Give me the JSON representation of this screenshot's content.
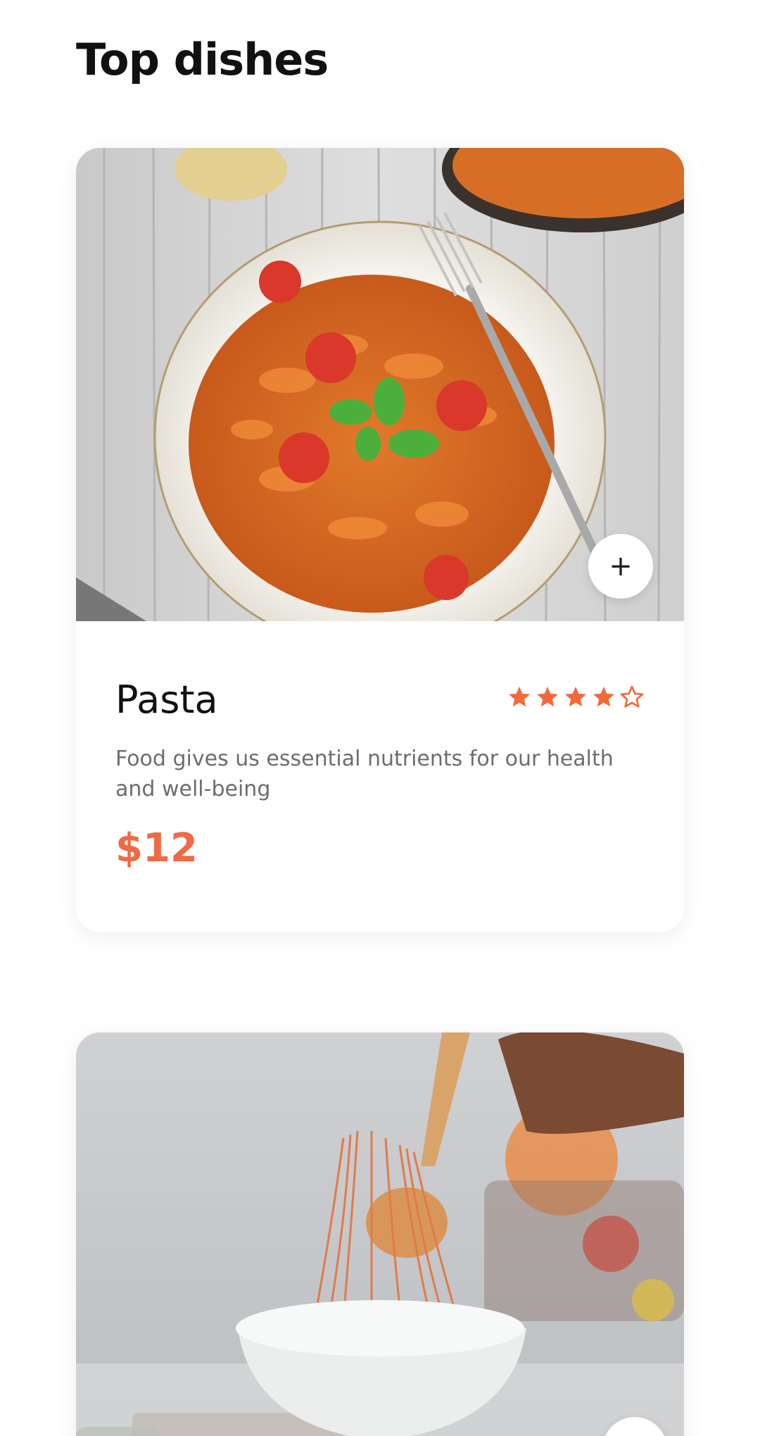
{
  "section": {
    "title": "Top dishes"
  },
  "dishes": [
    {
      "name": "Pasta",
      "rating": 4,
      "rating_max": 5,
      "description": "Food gives us essential nutrients for our health and well-being",
      "price": "$12",
      "add_label": "+"
    },
    {
      "add_label": "+"
    }
  ],
  "colors": {
    "accent": "#ef6a45",
    "star": "#f26a3c",
    "text": "#111111",
    "muted": "#6d6d6d"
  },
  "icons": {
    "add": "plus-icon",
    "star_filled": "star-filled-icon",
    "star_empty": "star-outline-icon"
  }
}
